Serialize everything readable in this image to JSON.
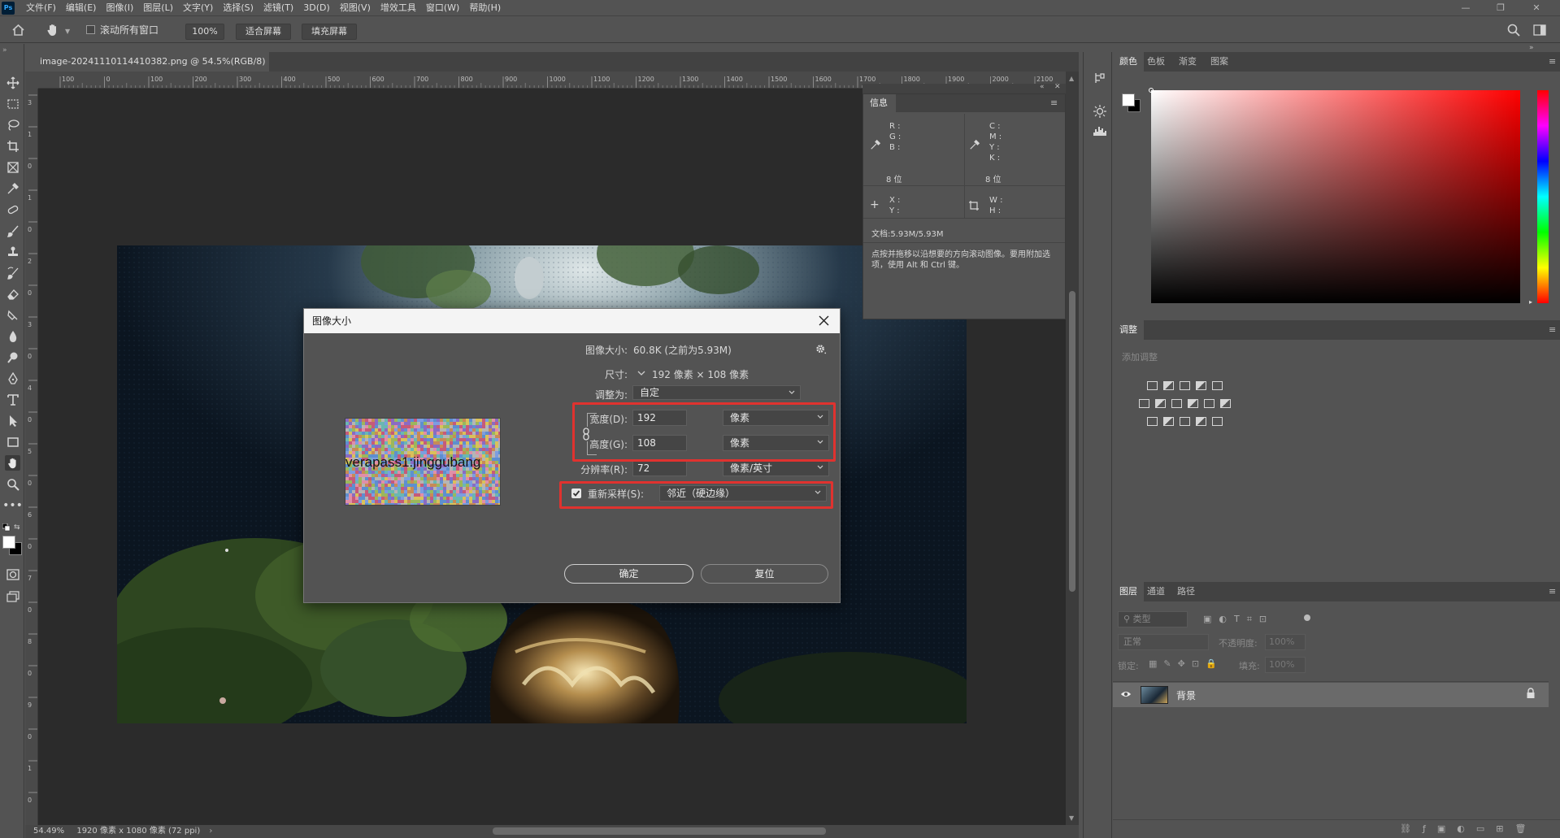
{
  "app": {
    "logo": "Ps"
  },
  "menu": [
    "文件(F)",
    "编辑(E)",
    "图像(I)",
    "图层(L)",
    "文字(Y)",
    "选择(S)",
    "滤镜(T)",
    "3D(D)",
    "视图(V)",
    "增效工具",
    "窗口(W)",
    "帮助(H)"
  ],
  "options": {
    "scroll_all_label": "滚动所有窗口",
    "zoom_value": "100%",
    "fit_screen_label": "适合屏幕",
    "fill_screen_label": "填充屏幕"
  },
  "document": {
    "tab_title": "image-20241110114410382.png @ 54.5%(RGB/8)",
    "tab_close": "×",
    "status_zoom": "54.49%",
    "status_info": "1920 像素 x 1080 像素 (72 ppi)",
    "ruler_h_ticks": [
      "100",
      "0",
      "100",
      "200",
      "300",
      "400",
      "500",
      "600",
      "700",
      "800",
      "900",
      "1000",
      "1100",
      "1200",
      "1300",
      "1400",
      "1500",
      "1600",
      "1700",
      "1800",
      "1900",
      "2000",
      "2100"
    ],
    "ruler_v_ticks": [
      "3",
      "1",
      "0",
      "1",
      "0",
      "2",
      "0",
      "3",
      "0",
      "4",
      "0",
      "5",
      "0",
      "6",
      "0",
      "7",
      "0",
      "8",
      "0",
      "9",
      "0",
      "1",
      "0"
    ]
  },
  "info_panel": {
    "title": "信息",
    "rgb_labels": [
      "R :",
      "G :",
      "B :"
    ],
    "cmyk_labels": [
      "C :",
      "M :",
      "Y :",
      "K :"
    ],
    "bits_left": "8 位",
    "bits_right": "8 位",
    "xy_labels": [
      "X :",
      "Y :"
    ],
    "wh_labels": [
      "W :",
      "H :"
    ],
    "doc_size": "文档:5.93M/5.93M",
    "hint": "点按并拖移以沿想要的方向滚动图像。要用附加选项，使用 Alt 和 Ctrl 键。"
  },
  "color_panel": {
    "tabs": [
      "颜色",
      "色板",
      "渐变",
      "图案"
    ]
  },
  "adjustments_panel": {
    "tab": "调整",
    "subtitle": "添加调整"
  },
  "layers_panel": {
    "tabs": [
      "图层",
      "通道",
      "路径"
    ],
    "filter_placeholder": "类型",
    "blend_mode": "正常",
    "opacity_label": "不透明度:",
    "opacity_value": "100%",
    "lock_label": "锁定:",
    "fill_label": "填充:",
    "fill_value": "100%",
    "layer_name": "背景"
  },
  "dialog": {
    "title": "图像大小",
    "image_size_label": "图像大小:",
    "image_size_value": "60.8K (之前为5.93M)",
    "dimensions_label": "尺寸:",
    "dimensions_value": "192 像素 × 108 像素",
    "fit_to_label": "调整为:",
    "fit_to_value": "自定",
    "width_label": "宽度(D):",
    "width_value": "192",
    "width_unit": "像素",
    "height_label": "高度(G):",
    "height_value": "108",
    "height_unit": "像素",
    "resolution_label": "分辨率(R):",
    "resolution_value": "72",
    "resolution_unit": "像素/英寸",
    "resample_label": "重新采样(S):",
    "resample_checked": true,
    "resample_value": "邻近（硬边缘）",
    "preview_text": "verapass1:jinggubang",
    "ok_label": "确定",
    "reset_label": "复位",
    "highlight_color": "#e0322f"
  }
}
